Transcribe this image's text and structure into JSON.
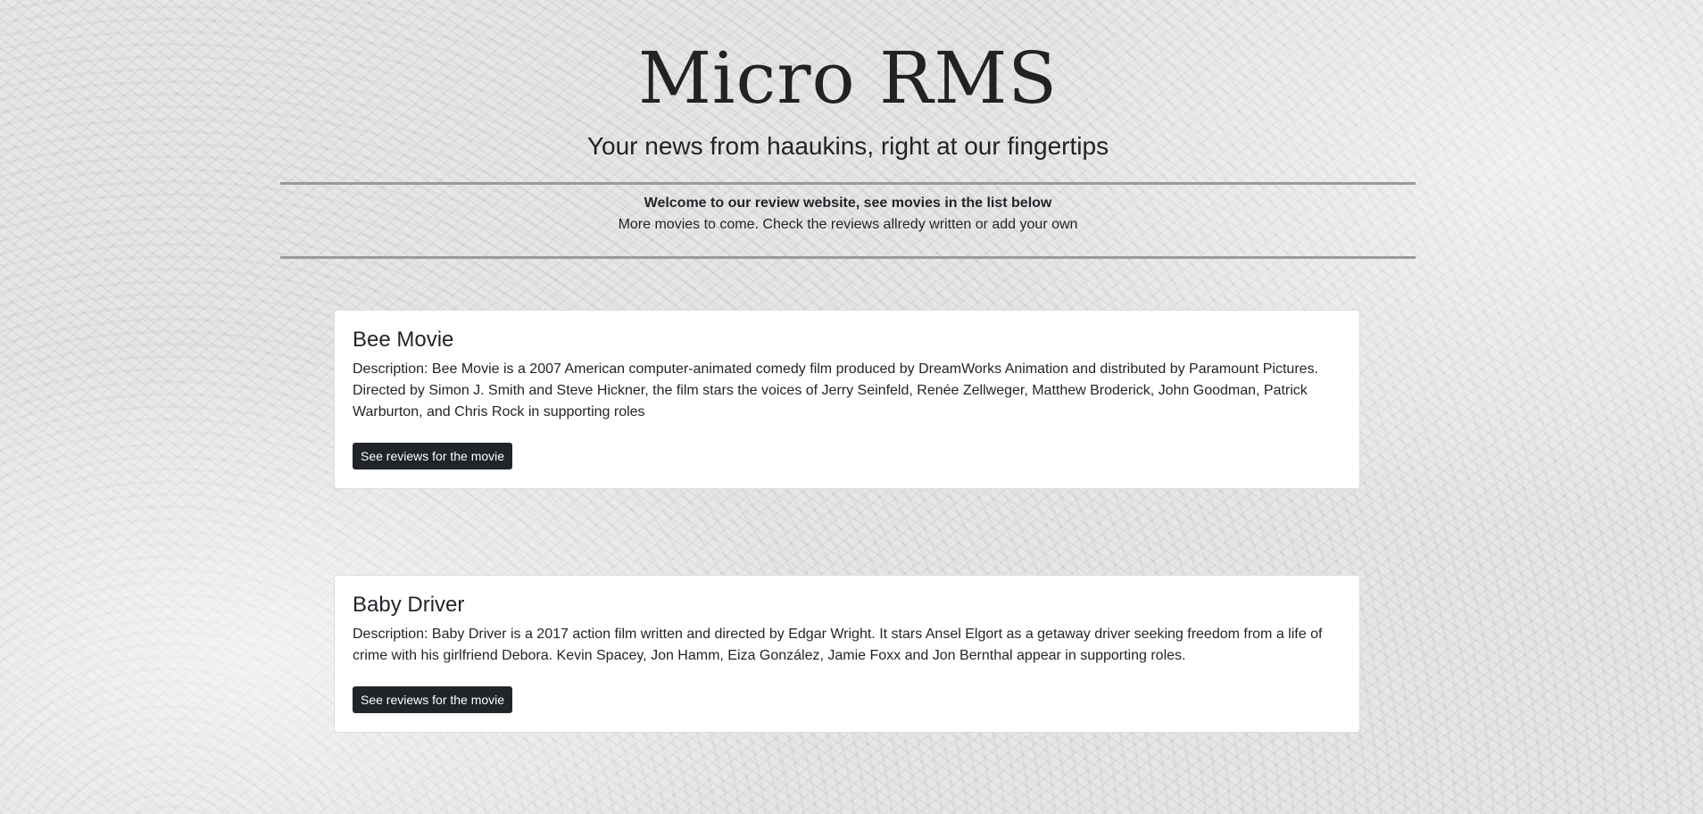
{
  "header": {
    "title": "Micro RMS",
    "tagline": "Your news from haaukins, right at our fingertips"
  },
  "welcome": {
    "headline": "Welcome to our review website, see movies in the list below",
    "subtext": "More movies to come. Check the reviews allredy written or add your own"
  },
  "movies": [
    {
      "title": "Bee Movie",
      "description": "Description: Bee Movie is a 2007 American computer-animated comedy film produced by DreamWorks Animation and distributed by Paramount Pictures. Directed by Simon J. Smith and Steve Hickner, the film stars the voices of Jerry Seinfeld, Renée Zellweger, Matthew Broderick, John Goodman, Patrick Warburton, and Chris Rock in supporting roles",
      "button_label": "See reviews for the movie"
    },
    {
      "title": "Baby Driver",
      "description": "Description: Baby Driver is a 2017 action film written and directed by Edgar Wright. It stars Ansel Elgort as a getaway driver seeking freedom from a life of crime with his girlfriend Debora. Kevin Spacey, Jon Hamm, Eiza González, Jamie Foxx and Jon Bernthal appear in supporting roles.",
      "button_label": "See reviews for the movie"
    }
  ],
  "colors": {
    "button_background": "#212529",
    "button_text": "#ffffff",
    "card_background": "#ffffff",
    "rule": "#9a9a9a"
  }
}
